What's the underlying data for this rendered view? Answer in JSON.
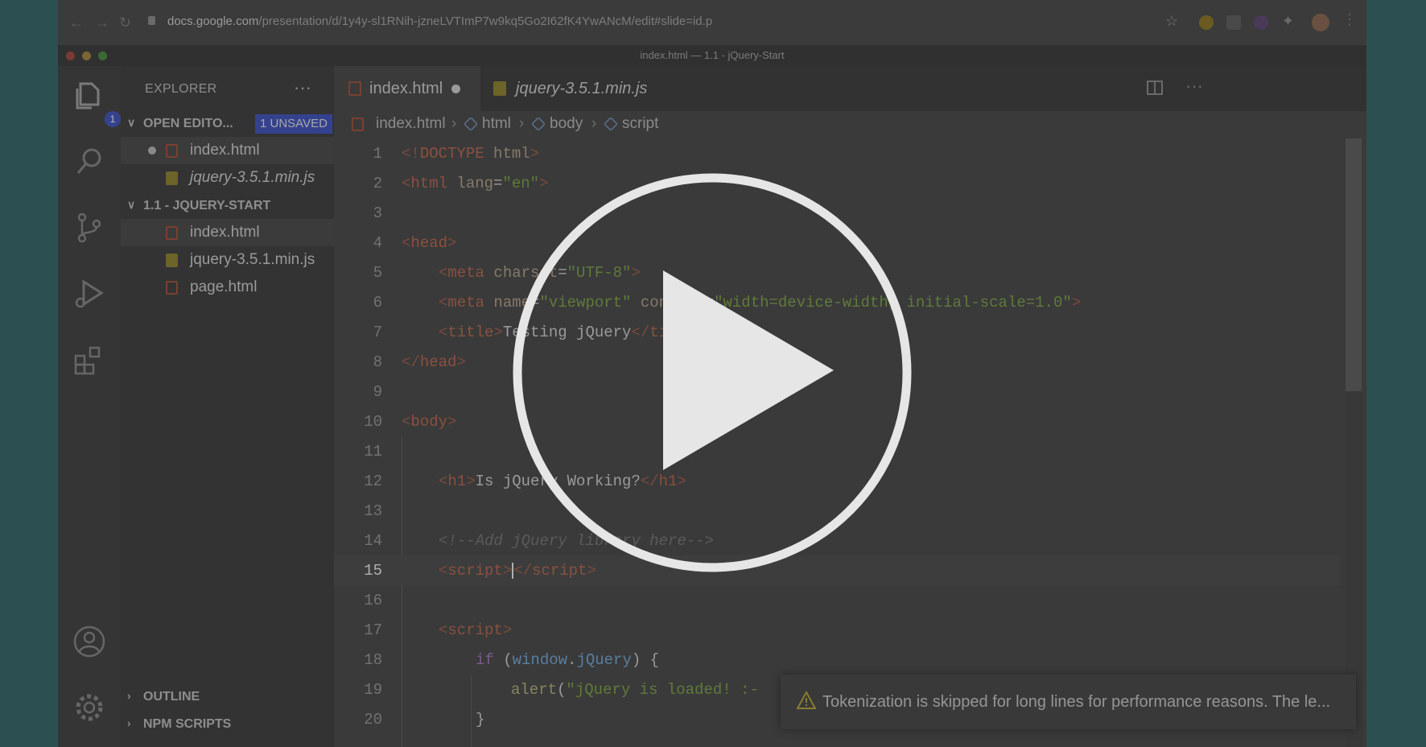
{
  "browser": {
    "url_host": "docs.google.com",
    "url_path": "/presentation/d/1y4y-sl1RNih-jzneLVTImP7w9kq5Go2I62fK4YwANcM/edit#slide=id.p"
  },
  "window": {
    "title": "index.html — 1.1 - jQuery-Start"
  },
  "activity_bar": {
    "explorer_badge": "1"
  },
  "sidebar": {
    "header": "EXPLORER",
    "more": "···",
    "open_editors": {
      "label": "OPEN EDITO...",
      "badge": "1 UNSAVED",
      "files": [
        {
          "name": "index.html",
          "type": "html",
          "modified": true
        },
        {
          "name": "jquery-3.5.1.min.js",
          "type": "js",
          "italic": true
        }
      ]
    },
    "project": {
      "label": "1.1 - JQUERY-START",
      "files": [
        {
          "name": "index.html",
          "type": "html",
          "selected": true
        },
        {
          "name": "jquery-3.5.1.min.js",
          "type": "js"
        },
        {
          "name": "page.html",
          "type": "html"
        }
      ]
    },
    "outline": "OUTLINE",
    "npm_scripts": "NPM SCRIPTS"
  },
  "tabs": [
    {
      "label": "index.html",
      "active": true,
      "modified": true
    },
    {
      "label": "jquery-3.5.1.min.js",
      "active": false,
      "italic": true
    }
  ],
  "breadcrumb": [
    "index.html",
    "html",
    "body",
    "script"
  ],
  "editor": {
    "current_line": 15,
    "line_numbers": [
      "1",
      "2",
      "3",
      "4",
      "5",
      "6",
      "7",
      "8",
      "9",
      "10",
      "11",
      "12",
      "13",
      "14",
      "15",
      "16",
      "17",
      "18",
      "19",
      "20"
    ],
    "lines": {
      "l1": [
        "<!",
        "DOCTYPE",
        " html",
        ">"
      ],
      "l2": [
        "<",
        "html",
        " lang",
        "=",
        "\"en\"",
        ">"
      ],
      "l4": [
        "<",
        "head",
        ">"
      ],
      "l5": [
        "<",
        "meta",
        " charset",
        "=",
        "\"UTF-8\"",
        ">"
      ],
      "l6": [
        "<",
        "meta",
        " name",
        "=",
        "\"viewport\"",
        " content",
        "=",
        "\"width=device-width, initial-scale=1.0\"",
        ">"
      ],
      "l7": [
        "<",
        "title",
        ">",
        "Testing jQuery",
        "</",
        "title",
        ">"
      ],
      "l8": [
        "</",
        "head",
        ">"
      ],
      "l10": [
        "<",
        "body",
        ">"
      ],
      "l12": [
        "<",
        "h1",
        ">",
        "Is jQuery Working?",
        "</",
        "h1",
        ">"
      ],
      "l14": [
        "<!--Add jQuery library here-->"
      ],
      "l15": [
        "<",
        "script",
        ">",
        "</",
        "script",
        ">"
      ],
      "l17": [
        "<",
        "script",
        ">"
      ],
      "l18": [
        "if",
        " (",
        "window",
        ".",
        "jQuery",
        ") {"
      ],
      "l19": [
        "alert",
        "(",
        "\"jQuery is loaded! :-"
      ],
      "l20": [
        "}"
      ]
    }
  },
  "notification": {
    "text": "Tokenization is skipped for long lines for performance reasons. The le..."
  },
  "overlay": {
    "type": "play-button"
  },
  "colors": {
    "outer_bg": "#2c4f52",
    "badge_blue": "#34428e",
    "overlay_white": "#e6e6e6"
  }
}
